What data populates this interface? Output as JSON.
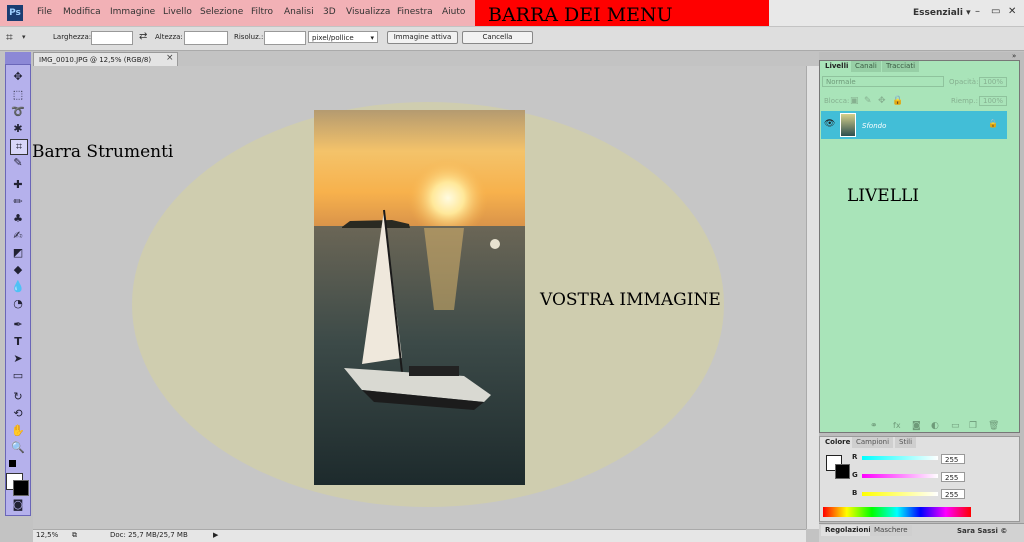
{
  "app": {
    "logo": "Ps"
  },
  "menubar": {
    "items": [
      "File",
      "Modifica",
      "Immagine",
      "Livello",
      "Selezione",
      "Filtro",
      "Analisi",
      "3D",
      "Visualizza",
      "Finestra",
      "Aiuto"
    ],
    "annotation": "BARRA DEI MENU",
    "workspace": "Essenziali",
    "highlight_color": "#f2b1b6",
    "annotation_color": "#ff0000"
  },
  "options": {
    "width_label": "Larghezza:",
    "height_label": "Altezza:",
    "resolution_label": "Risoluz.:",
    "units": "pixel/pollice",
    "front_image_button": "Immagine attiva",
    "clear_button": "Cancella"
  },
  "document": {
    "tab_title": "IMG_0010.JPG @ 12,5% (RGB/8)",
    "zoom": "12,5%",
    "doc_size": "Doc: 25,7 MB/25,7 MB"
  },
  "annotations": {
    "tools": "Barra Strumenti",
    "image": "VOSTRA IMMAGINE",
    "layers": "LIVELLI"
  },
  "toolbar": {
    "color": "#b5b1ec"
  },
  "layers_panel": {
    "tabs": [
      "Livelli",
      "Canali",
      "Tracciati"
    ],
    "blend_mode": "Normale",
    "opacity_label": "Opacità:",
    "opacity_value": "100%",
    "lock_label": "Blocca:",
    "fill_label": "Riemp.:",
    "fill_value": "100%",
    "layer_name": "Sfondo",
    "panel_color": "#a9e4b9",
    "selected_row_color": "#42bed7"
  },
  "color_panel": {
    "tabs": [
      "Colore",
      "Campioni",
      "Stili"
    ],
    "r_label": "R",
    "r_value": "255",
    "g_label": "G",
    "g_value": "255",
    "b_label": "B",
    "b_value": "255"
  },
  "bottom_panel": {
    "tabs": [
      "Regolazioni",
      "Maschere"
    ],
    "user": "Sara Sassi ©"
  }
}
